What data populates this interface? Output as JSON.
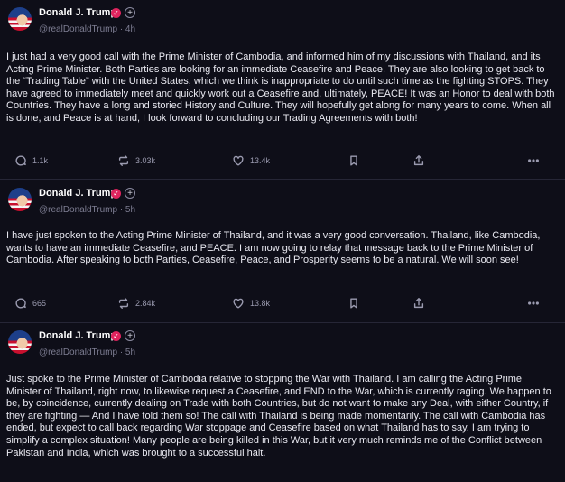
{
  "posts": [
    {
      "author": "Donald J. Trump",
      "handle_time": "@realDonaldTrump · 4h",
      "body": "I just had a very good call with the Prime Minister of Cambodia, and informed him of my discussions with Thailand, and its Acting Prime Minister. Both Parties are looking for an immediate Ceasefire and Peace. They are also looking to get back to the “Trading Table” with the United States, which we think is inappropriate to do until such time as the fighting STOPS. They have agreed to immediately meet and quickly work out a Ceasefire and, ultimately, PEACE! It was an Honor to deal with both Countries. They have a long and storied History and Culture. They will hopefully get along for many years to come. When all is done, and Peace is at hand, I look forward to concluding our Trading Agreements with both!",
      "replies": "1.1k",
      "retruths": "3.03k",
      "likes": "13.4k"
    },
    {
      "author": "Donald J. Trump",
      "handle_time": "@realDonaldTrump · 5h",
      "body": "I have just spoken to the Acting Prime Minister of Thailand, and it was a very good conversation. Thailand, like Cambodia, wants to have an immediate Ceasefire, and PEACE. I am now going to relay that message back to the Prime Minister of Cambodia. After speaking to both Parties, Ceasefire, Peace, and Prosperity seems to be a natural. We will soon see!",
      "replies": "665",
      "retruths": "2.84k",
      "likes": "13.8k"
    },
    {
      "author": "Donald J. Trump",
      "handle_time": "@realDonaldTrump · 5h",
      "body": "Just spoke to the Prime Minister of Cambodia relative to stopping the War with Thailand. I am calling the Acting Prime Minister of Thailand, right now, to likewise request a Ceasefire, and END to the War, which is currently raging. We happen to be, by coincidence, currently dealing on Trade with both Countries, but do not want to make any Deal, with either Country, if they are fighting — And I have told them so! The call with Thailand is being made momentarily. The call with Cambodia has ended, but expect to call back regarding War stoppage and Ceasefire based on what Thailand has to say. I am trying to simplify a complex situation! Many people are being killed in this War, but it very much reminds me of the Conflict between Pakistan and India, which was brought to a successful halt."
    }
  ],
  "icons": {
    "verified": "verified-badge-icon",
    "plus": "plus-icon",
    "reply": "reply-icon",
    "retruth": "retruth-icon",
    "like": "heart-icon",
    "bookmark": "bookmark-icon",
    "share": "share-icon",
    "more": "more-icon"
  },
  "colors": {
    "background": "#0e0e18",
    "verified": "#e0245e",
    "muted": "#7d7d92"
  }
}
